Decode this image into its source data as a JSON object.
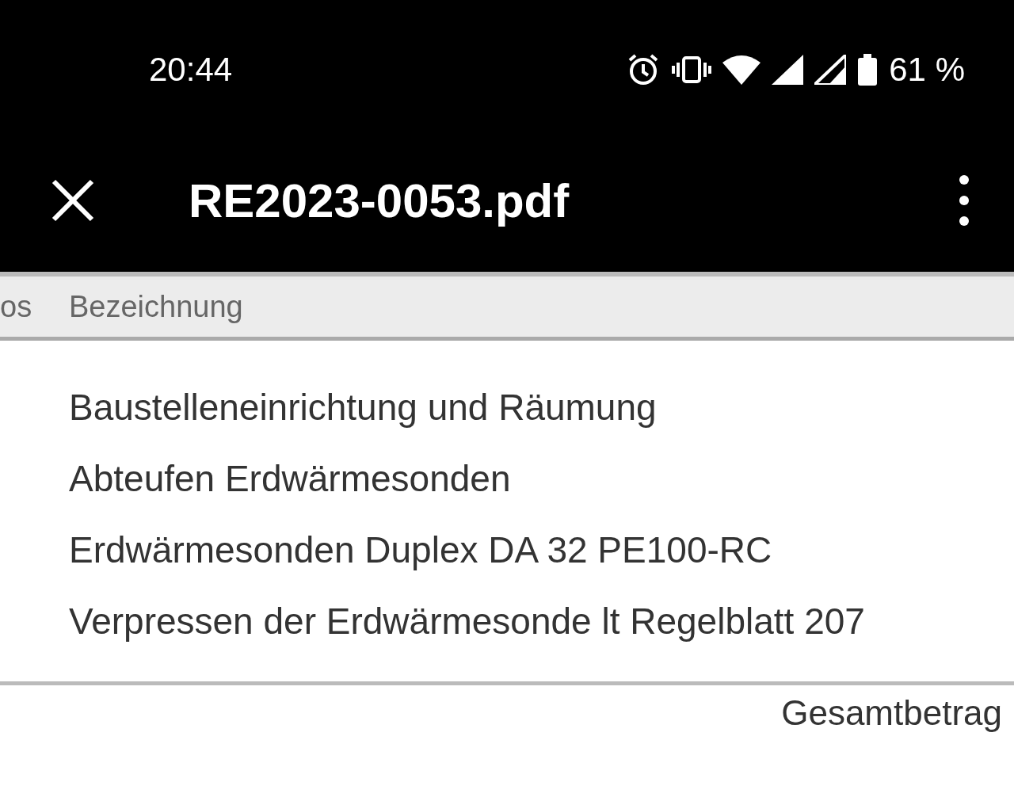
{
  "status_bar": {
    "time": "20:44",
    "battery": "61 %"
  },
  "toolbar": {
    "title": "RE2023-0053.pdf"
  },
  "table": {
    "columns": [
      "os",
      "Bezeichnung"
    ],
    "rows": [
      {
        "description": "Baustelleneinrichtung und Räumung"
      },
      {
        "description": "Abteufen Erdwärmesonden"
      },
      {
        "description": "Erdwärmesonden Duplex DA 32 PE100-RC"
      },
      {
        "description": "Verpressen der Erdwärmesonde lt Regelblatt 207"
      }
    ],
    "total_label": "Gesamtbetrag"
  }
}
